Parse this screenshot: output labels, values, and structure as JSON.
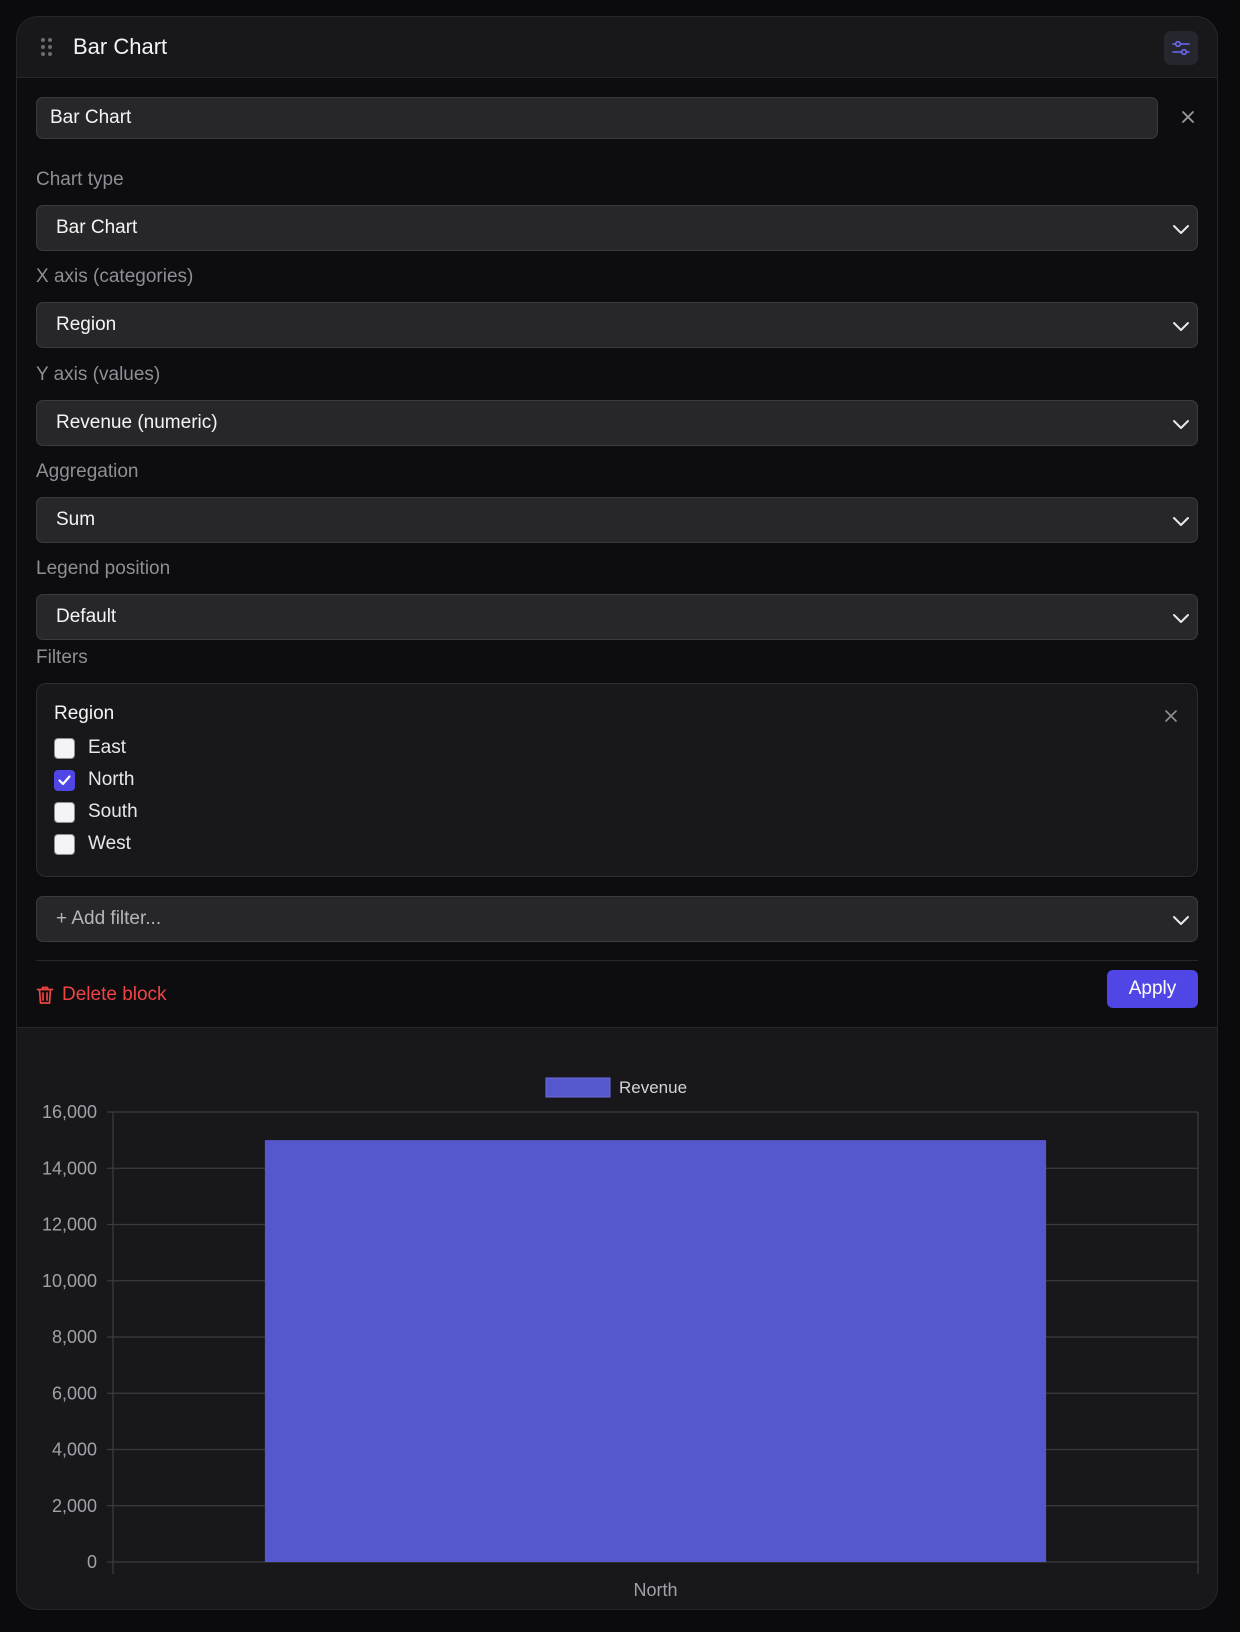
{
  "block": {
    "title": "Bar Chart",
    "title_input_value": "Bar Chart"
  },
  "fields": {
    "chart_type": {
      "label": "Chart type",
      "value": "Bar Chart"
    },
    "x_axis": {
      "label": "X axis (categories)",
      "value": "Region"
    },
    "y_axis": {
      "label": "Y axis (values)",
      "value": "Revenue (numeric)"
    },
    "aggregation": {
      "label": "Aggregation",
      "value": "Sum"
    },
    "legend_position": {
      "label": "Legend position",
      "value": "Default"
    }
  },
  "filters": {
    "label": "Filters",
    "groups": [
      {
        "title": "Region",
        "options": [
          {
            "label": "East",
            "checked": false
          },
          {
            "label": "North",
            "checked": true
          },
          {
            "label": "South",
            "checked": false
          },
          {
            "label": "West",
            "checked": false
          }
        ]
      }
    ],
    "add_filter_placeholder": "+ Add filter..."
  },
  "actions": {
    "delete_label": "Delete block",
    "apply_label": "Apply"
  },
  "colors": {
    "accent": "#4f46e5",
    "bar": "#5558cc",
    "danger": "#ef4444"
  },
  "icons": [
    "drag-handle-icon",
    "settings-sliders-icon",
    "close-icon",
    "chevron-down-icon",
    "trash-icon",
    "checkmark-icon"
  ],
  "chart_data": {
    "type": "bar",
    "categories": [
      "North"
    ],
    "series": [
      {
        "name": "Revenue",
        "values": [
          15000
        ]
      }
    ],
    "ylim": [
      0,
      16000
    ],
    "yticks": [
      0,
      2000,
      4000,
      6000,
      8000,
      10000,
      12000,
      14000,
      16000
    ],
    "legend": "top-center",
    "grid": true
  }
}
